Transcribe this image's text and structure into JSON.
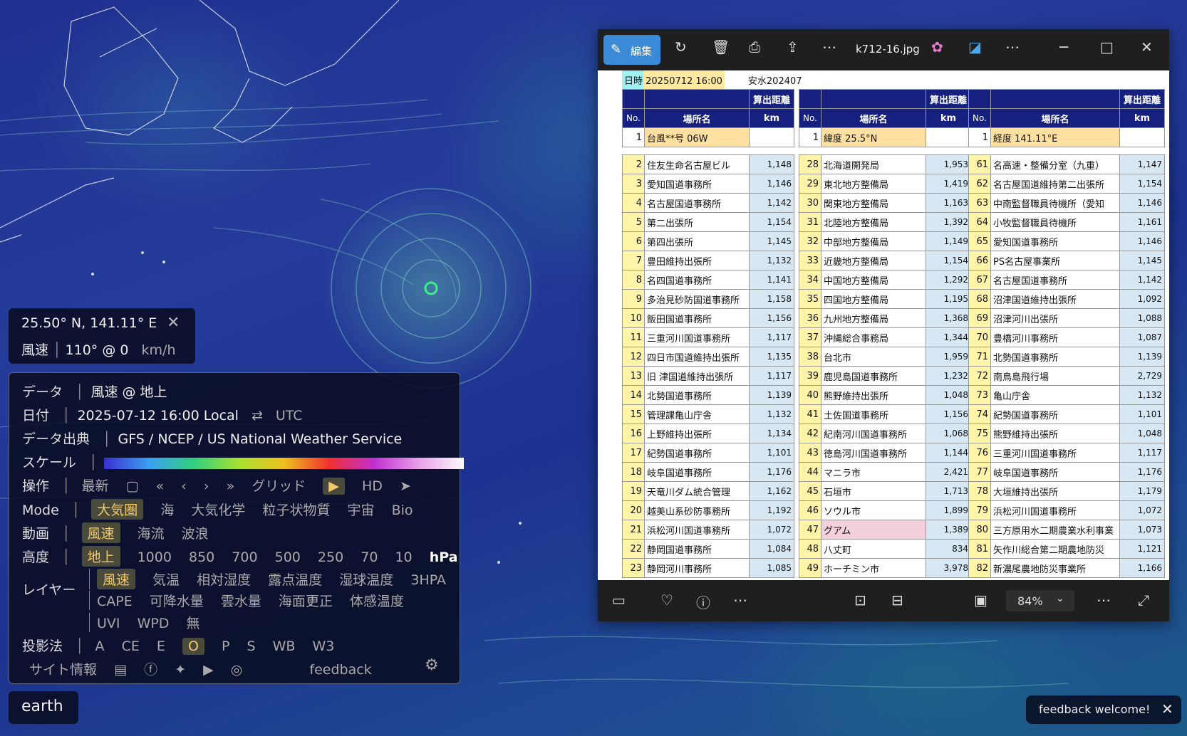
{
  "coords": {
    "latlon": "25.50° N, 141.11° E",
    "wind_label": "風速",
    "wind_value": "110° @ 0",
    "wind_unit": "km/h"
  },
  "menu": {
    "data_label": "データ",
    "data_value": "風速 @ 地上",
    "date_label": "日付",
    "date_value": "2025-07-12 16:00 Local",
    "date_toggle": "⇄",
    "date_utc": "UTC",
    "source_label": "データ出典",
    "source_value": "GFS / NCEP / US National Weather Service",
    "scale_label": "スケール",
    "ops_label": "操作",
    "ops_latest": "最新",
    "ops_calendar": "▢",
    "ops_ff_back": "«",
    "ops_back": "‹",
    "ops_fwd": "›",
    "ops_ff_fwd": "»",
    "ops_grid": "グリッド",
    "ops_play": "▶",
    "ops_hd": "HD",
    "ops_locate": "➤",
    "mode_label": "Mode",
    "modes": [
      "大気圏",
      "海",
      "大気化学",
      "粒子状物質",
      "宇宙",
      "Bio"
    ],
    "anim_label": "動画",
    "anims": [
      "風速",
      "海流",
      "波浪"
    ],
    "height_label": "高度",
    "heights": [
      "地上",
      "1000",
      "850",
      "700",
      "500",
      "250",
      "70",
      "10",
      "hPa"
    ],
    "layer_label": "レイヤー",
    "layers1": [
      "風速",
      "気温",
      "相対湿度",
      "露点温度",
      "湿球温度",
      "3HPA"
    ],
    "layers2": [
      "CAPE",
      "可降水量",
      "雲水量",
      "海面更正",
      "体感温度"
    ],
    "layers3": [
      "UVI",
      "WPD",
      "無"
    ],
    "proj_label": "投影法",
    "projs": [
      "A",
      "CE",
      "E",
      "O",
      "P",
      "S",
      "WB",
      "W3"
    ],
    "about": "サイト情報",
    "feedback": "feedback"
  },
  "earth_label": "earth",
  "feedback_welcome": "feedback welcome!",
  "viewer": {
    "edit_label": "編集",
    "filename": "k712-16.jpg",
    "zoom": "84%",
    "title_date": "日時 20250712 16:00",
    "title_right": "安水202407",
    "col_dist": "算出距離",
    "col_no": "No.",
    "col_name": "場所名",
    "col_km": "km",
    "first": [
      {
        "no": "1",
        "name": "台風**号 06W"
      },
      {
        "no": "1",
        "name": "緯度 25.5°N"
      },
      {
        "no": "1",
        "name": "経度 141.11°E"
      }
    ],
    "col1": [
      [
        "2",
        "住友生命名古屋ビル",
        "1,148"
      ],
      [
        "3",
        "愛知国道事務所",
        "1,146"
      ],
      [
        "4",
        "名古屋国道事務所",
        "1,142"
      ],
      [
        "5",
        "第二出張所",
        "1,154"
      ],
      [
        "6",
        "第四出張所",
        "1,145"
      ],
      [
        "7",
        "豊田維持出張所",
        "1,132"
      ],
      [
        "8",
        "名四国道事務所",
        "1,141"
      ],
      [
        "9",
        "多治見砂防国道事務所",
        "1,158"
      ],
      [
        "10",
        "飯田国道事務所",
        "1,156"
      ],
      [
        "11",
        "三重河川国道事務所",
        "1,117"
      ],
      [
        "12",
        "四日市国道維持出張所",
        "1,135"
      ],
      [
        "13",
        "旧 津国道維持出張所",
        "1,117"
      ],
      [
        "14",
        "北勢国道事務所",
        "1,139"
      ],
      [
        "15",
        "管理課亀山庁舎",
        "1,132"
      ],
      [
        "16",
        "上野維持出張所",
        "1,134"
      ],
      [
        "17",
        "紀勢国道事務所",
        "1,101"
      ],
      [
        "18",
        "岐阜国道事務所",
        "1,176"
      ],
      [
        "19",
        "天竜川ダム統合管理",
        "1,162"
      ],
      [
        "20",
        "越美山系砂防事務所",
        "1,192"
      ],
      [
        "21",
        "浜松河川国道事務所",
        "1,072"
      ],
      [
        "22",
        "静岡国道事務所",
        "1,084"
      ],
      [
        "23",
        "静岡河川事務所",
        "1,085"
      ]
    ],
    "col2": [
      [
        "28",
        "北海道開発局",
        "1,953"
      ],
      [
        "29",
        "東北地方整備局",
        "1,419"
      ],
      [
        "30",
        "関東地方整備局",
        "1,163"
      ],
      [
        "31",
        "北陸地方整備局",
        "1,392"
      ],
      [
        "32",
        "中部地方整備局",
        "1,149"
      ],
      [
        "33",
        "近畿地方整備局",
        "1,154"
      ],
      [
        "34",
        "中国地方整備局",
        "1,292"
      ],
      [
        "35",
        "四国地方整備局",
        "1,195"
      ],
      [
        "36",
        "九州地方整備局",
        "1,368"
      ],
      [
        "37",
        "沖縄総合事務局",
        "1,344"
      ],
      [
        "38",
        "台北市",
        "1,959"
      ],
      [
        "39",
        "鹿児島国道事務所",
        "1,232"
      ],
      [
        "40",
        "熊野維持出張所",
        "1,048"
      ],
      [
        "41",
        "土佐国道事務所",
        "1,156"
      ],
      [
        "42",
        "紀南河川国道事務所",
        "1,068"
      ],
      [
        "43",
        "徳島河川国道事務所",
        "1,144"
      ],
      [
        "44",
        "マニラ市",
        "2,421"
      ],
      [
        "45",
        "石垣市",
        "1,713"
      ],
      [
        "46",
        "ソウル市",
        "1,899"
      ],
      [
        "47",
        "グアム",
        "1,389"
      ],
      [
        "48",
        "八丈町",
        "834"
      ],
      [
        "49",
        "ホーチミン市",
        "3,978"
      ]
    ],
    "col3": [
      [
        "61",
        "名高速・整備分室（九重）",
        "1,147"
      ],
      [
        "62",
        "名古屋国道維持第二出張所",
        "1,154"
      ],
      [
        "63",
        "中南監督職員待機所（愛知",
        "1,146"
      ],
      [
        "64",
        "小牧監督職員待機所",
        "1,161"
      ],
      [
        "65",
        "愛知国道事務所",
        "1,146"
      ],
      [
        "66",
        "PS名古屋事業所",
        "1,145"
      ],
      [
        "67",
        "名古屋国道事務所",
        "1,142"
      ],
      [
        "68",
        "沼津国道維持出張所",
        "1,092"
      ],
      [
        "69",
        "沼津河川出張所",
        "1,088"
      ],
      [
        "70",
        "豊橋河川事務所",
        "1,087"
      ],
      [
        "71",
        "北勢国道事務所",
        "1,139"
      ],
      [
        "72",
        "南鳥島飛行場",
        "2,729"
      ],
      [
        "73",
        "亀山庁舎",
        "1,132"
      ],
      [
        "74",
        "紀勢国道事務所",
        "1,101"
      ],
      [
        "75",
        "熊野維持出張所",
        "1,048"
      ],
      [
        "76",
        "三重河川国道事務所",
        "1,117"
      ],
      [
        "77",
        "岐阜国道事務所",
        "1,176"
      ],
      [
        "78",
        "大垣維持出張所",
        "1,179"
      ],
      [
        "79",
        "浜松河川国道事務所",
        "1,072"
      ],
      [
        "80",
        "三方原用水二期農業水利事業",
        "1,073"
      ],
      [
        "81",
        "矢作川総合第二期農地防災",
        "1,121"
      ],
      [
        "82",
        "新濃尾農地防災事業所",
        "1,166"
      ]
    ]
  }
}
